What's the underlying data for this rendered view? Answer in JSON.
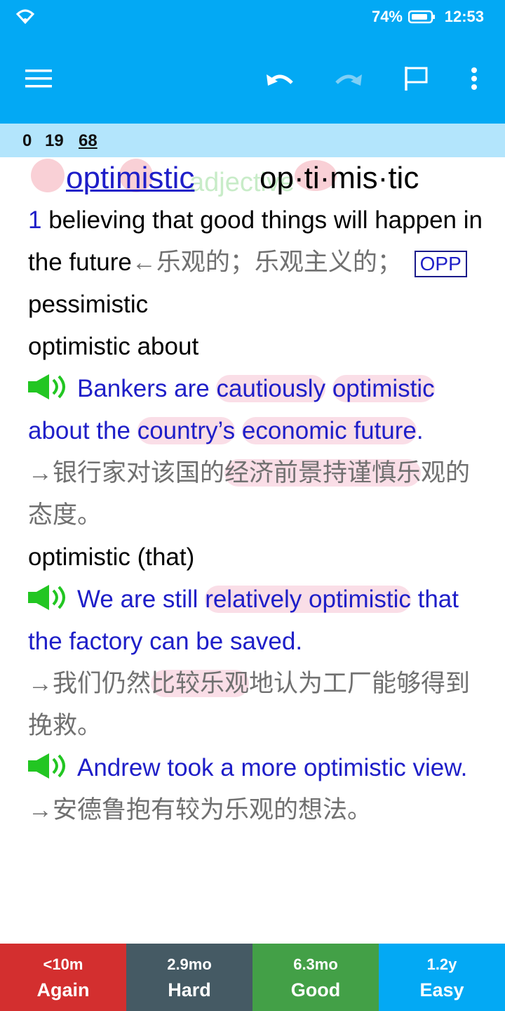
{
  "status_bar": {
    "battery": "74%",
    "time": "12:53",
    "wifi_icon": "wifi-icon",
    "battery_icon": "battery-icon"
  },
  "toolbar": {
    "menu_icon": "hamburger-menu-icon",
    "undo_icon": "undo-icon",
    "redo_icon": "redo-icon",
    "flag_icon": "flag-icon",
    "more_icon": "more-vert-icon"
  },
  "counts": {
    "new": "0",
    "learning": "19",
    "review": "68"
  },
  "card": {
    "word": "optimistic",
    "part_of_speech": "adjective",
    "syllables": "op·ti·mis·tic",
    "sense_number": "1",
    "definition": "believing that good things will happen in the future",
    "definition_cn": "←乐观的；乐观主义的；",
    "opp_label": "OPP",
    "opposite": "pessimistic",
    "pattern1": "optimistic about",
    "example1": {
      "before": "Bankers are ",
      "hl1": "cautiously",
      "hl2": "optimistic",
      "mid": " about the ",
      "hl3": "country’s",
      "hl4": "economic future",
      "end": "."
    },
    "translation1": {
      "before": "→银行家对该国的",
      "hl": "经济前景持谨慎乐",
      "after": "观的态度。"
    },
    "pattern2": "optimistic (that)",
    "example2": {
      "before": "We are still ",
      "hl": "relatively optimistic",
      "after": " that the factory can be saved."
    },
    "translation2": {
      "before": "→我们仍然",
      "hl": "比较乐观",
      "after": "地认为工厂能够得到挽救。"
    },
    "example3": "Andrew took a more optimistic view.",
    "translation3": "→安德鲁抱有较为乐观的想法。"
  },
  "answers": [
    {
      "interval": "<10m",
      "label": "Again",
      "color": "#D32F2F"
    },
    {
      "interval": "2.9mo",
      "label": "Hard",
      "color": "#455A64"
    },
    {
      "interval": "6.3mo",
      "label": "Good",
      "color": "#43A047"
    },
    {
      "interval": "1.2y",
      "label": "Easy",
      "color": "#03A9F4"
    }
  ],
  "colors": {
    "accent": "#03A9F4",
    "example_blue": "#1E1EC8",
    "highlight": "#F8C8CF",
    "speaker_green": "#22C622"
  }
}
